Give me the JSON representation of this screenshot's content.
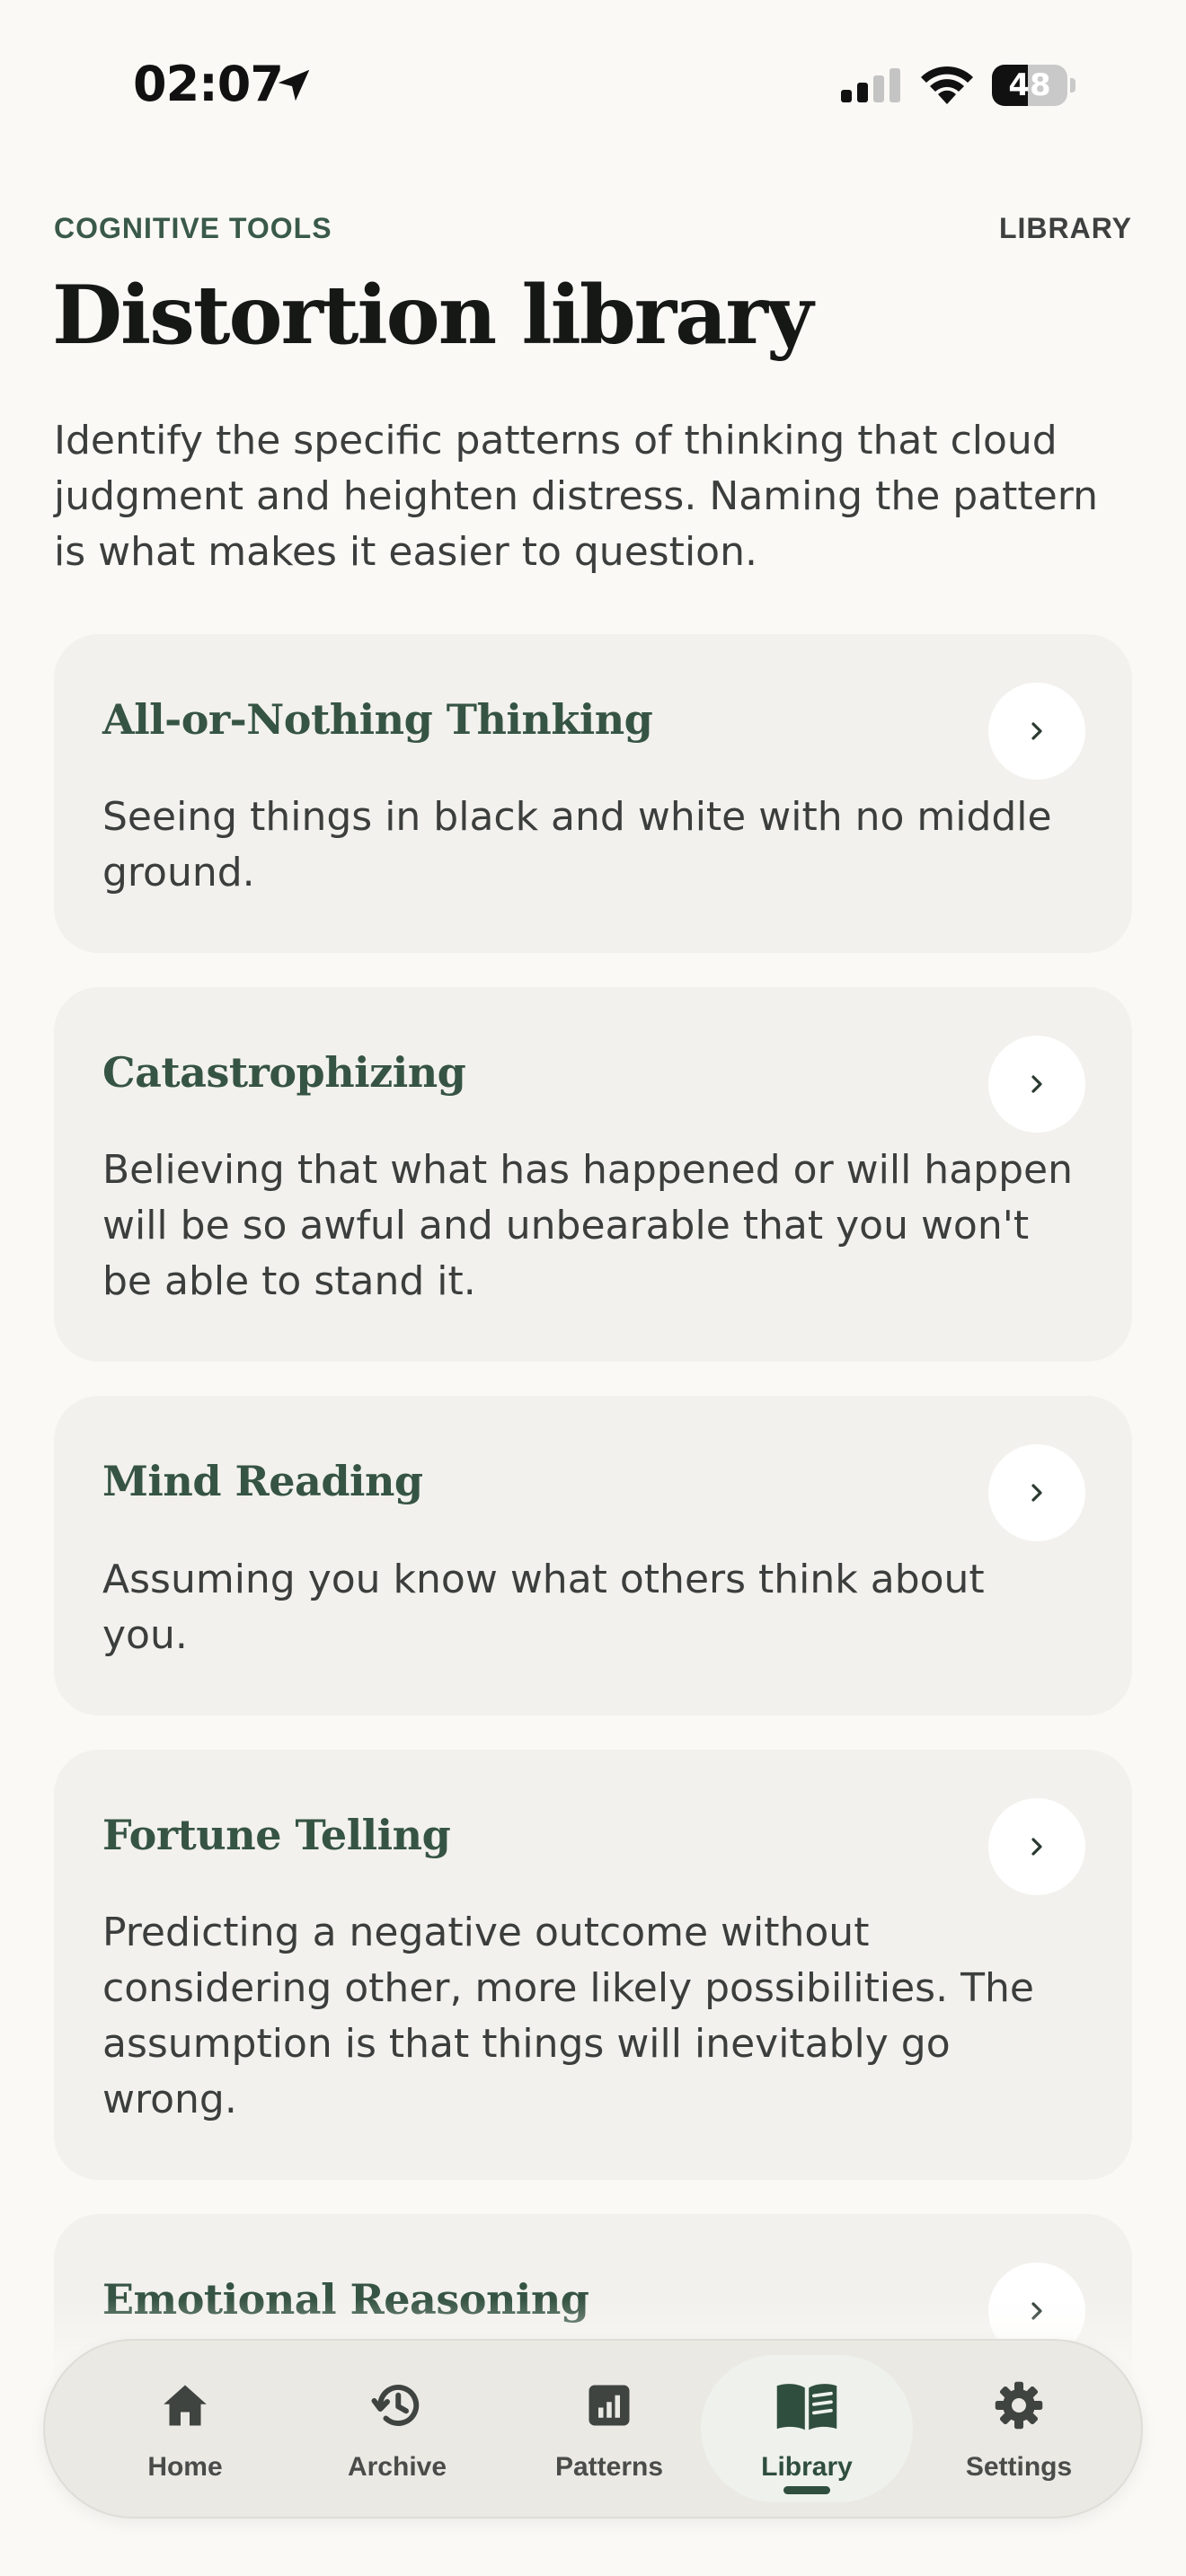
{
  "status_bar": {
    "time": "02:07",
    "battery_level": "48",
    "battery_fraction": 0.48
  },
  "header": {
    "eyebrow": "COGNITIVE TOOLS",
    "section_tag": "LIBRARY",
    "title": "Distortion library",
    "intro": "Identify the specific patterns of thinking that cloud judgment and heighten distress. Naming the pattern is what makes it easier to question."
  },
  "distortions": [
    {
      "title": "All-or-Nothing Thinking",
      "description": "Seeing things in black and white with no middle ground."
    },
    {
      "title": "Catastrophizing",
      "description": "Believing that what has happened or will happen will be so awful and unbearable that you won't be able to stand it."
    },
    {
      "title": "Mind Reading",
      "description": "Assuming you know what others think about you."
    },
    {
      "title": "Fortune Telling",
      "description": "Predicting a negative outcome without considering other, more likely possibilities. The assumption is that things will inevitably go wrong."
    },
    {
      "title": "Emotional Reasoning",
      "description": ""
    }
  ],
  "chevron_glyph": "›",
  "tab_bar": {
    "tabs": [
      {
        "label": "Home",
        "icon": "home-icon"
      },
      {
        "label": "Archive",
        "icon": "history-icon"
      },
      {
        "label": "Patterns",
        "icon": "bar-chart-icon"
      },
      {
        "label": "Library",
        "icon": "book-open-icon",
        "active": true
      },
      {
        "label": "Settings",
        "icon": "gear-icon"
      }
    ]
  },
  "colors": {
    "background": "#faf9f6",
    "card": "#f2f1ed",
    "accent_green": "#365443",
    "text": "#3b3e3c"
  }
}
